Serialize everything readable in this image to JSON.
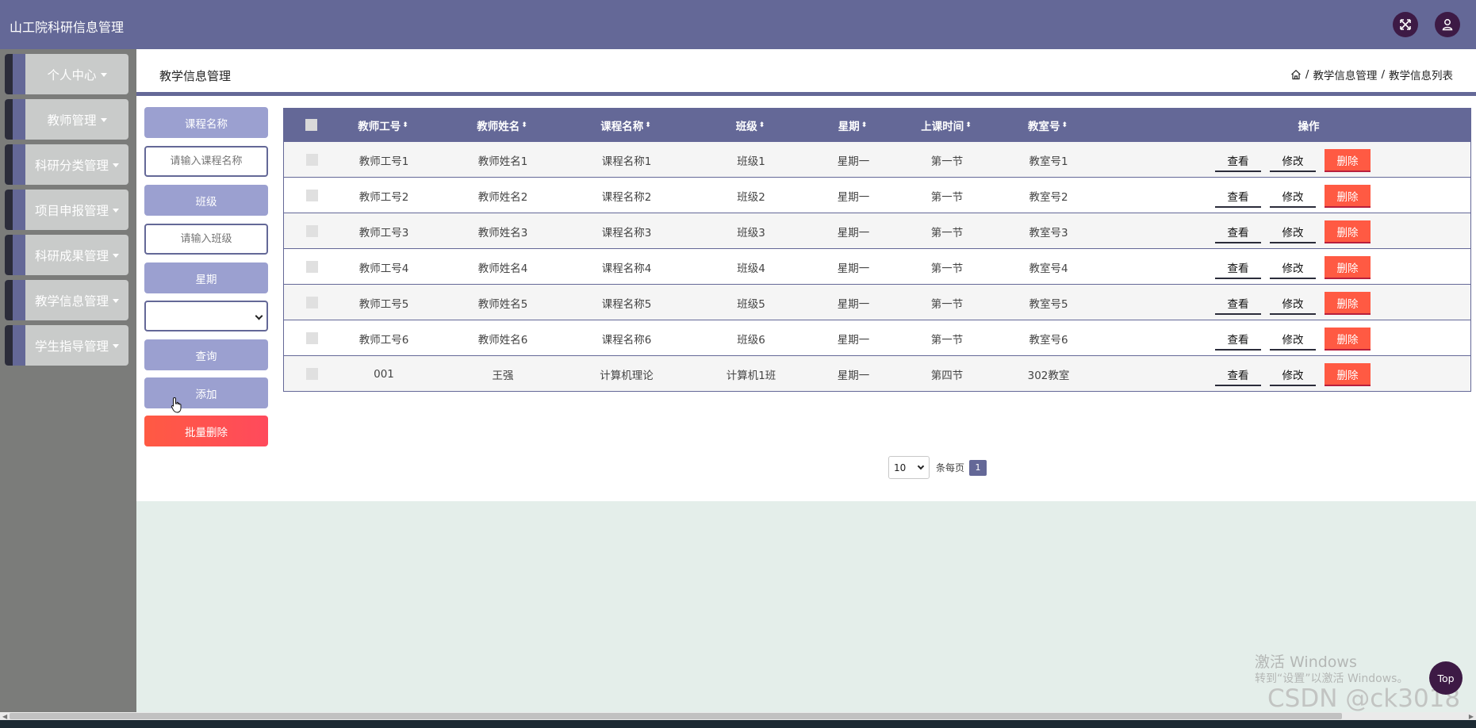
{
  "app": {
    "title": "山工院科研信息管理"
  },
  "header_icons": {
    "fullscreen": "expand-icon",
    "user": "user-icon"
  },
  "sidebar": {
    "items": [
      {
        "label": "个人中心"
      },
      {
        "label": "教师管理"
      },
      {
        "label": "科研分类管理"
      },
      {
        "label": "项目申报管理"
      },
      {
        "label": "科研成果管理"
      },
      {
        "label": "教学信息管理"
      },
      {
        "label": "学生指导管理"
      }
    ]
  },
  "page": {
    "title": "教学信息管理",
    "breadcrumb": [
      "教学信息管理",
      "教学信息列表"
    ],
    "breadcrumb_sep": "/"
  },
  "filters": {
    "course_label": "课程名称",
    "course_placeholder": "请输入课程名称",
    "class_label": "班级",
    "class_placeholder": "请输入班级",
    "week_label": "星期",
    "week_value": "",
    "search_button": "查询",
    "add_button": "添加",
    "batch_delete_button": "批量删除"
  },
  "table": {
    "columns": [
      "教师工号",
      "教师姓名",
      "课程名称",
      "班级",
      "星期",
      "上课时间",
      "教室号"
    ],
    "sort_glyph": "⬍",
    "actions_header": "操作",
    "rows": [
      [
        "教师工号1",
        "教师姓名1",
        "课程名称1",
        "班级1",
        "星期一",
        "第一节",
        "教室号1"
      ],
      [
        "教师工号2",
        "教师姓名2",
        "课程名称2",
        "班级2",
        "星期一",
        "第一节",
        "教室号2"
      ],
      [
        "教师工号3",
        "教师姓名3",
        "课程名称3",
        "班级3",
        "星期一",
        "第一节",
        "教室号3"
      ],
      [
        "教师工号4",
        "教师姓名4",
        "课程名称4",
        "班级4",
        "星期一",
        "第一节",
        "教室号4"
      ],
      [
        "教师工号5",
        "教师姓名5",
        "课程名称5",
        "班级5",
        "星期一",
        "第一节",
        "教室号5"
      ],
      [
        "教师工号6",
        "教师姓名6",
        "课程名称6",
        "班级6",
        "星期一",
        "第一节",
        "教室号6"
      ],
      [
        "001",
        "王强",
        "计算机理论",
        "计算机1班",
        "星期一",
        "第四节",
        "302教室"
      ]
    ],
    "row_actions": {
      "view": "查看",
      "edit": "修改",
      "delete": "删除"
    }
  },
  "pagination": {
    "page_size": "10",
    "per_page_label": "条每页",
    "current_page": "1"
  },
  "watermark": {
    "line1": "激活 Windows",
    "line2": "转到“设置”以激活 Windows。",
    "line3": "CSDN @ck3018"
  },
  "back_to_top": "Top",
  "colors": {
    "primary": "#646897",
    "light_primary": "#9ba0d0",
    "danger": "#ff5a43",
    "dark_circle": "#3d1a45",
    "sidebar_bg": "#7b7c7a",
    "page_bg": "#e4eeea"
  }
}
